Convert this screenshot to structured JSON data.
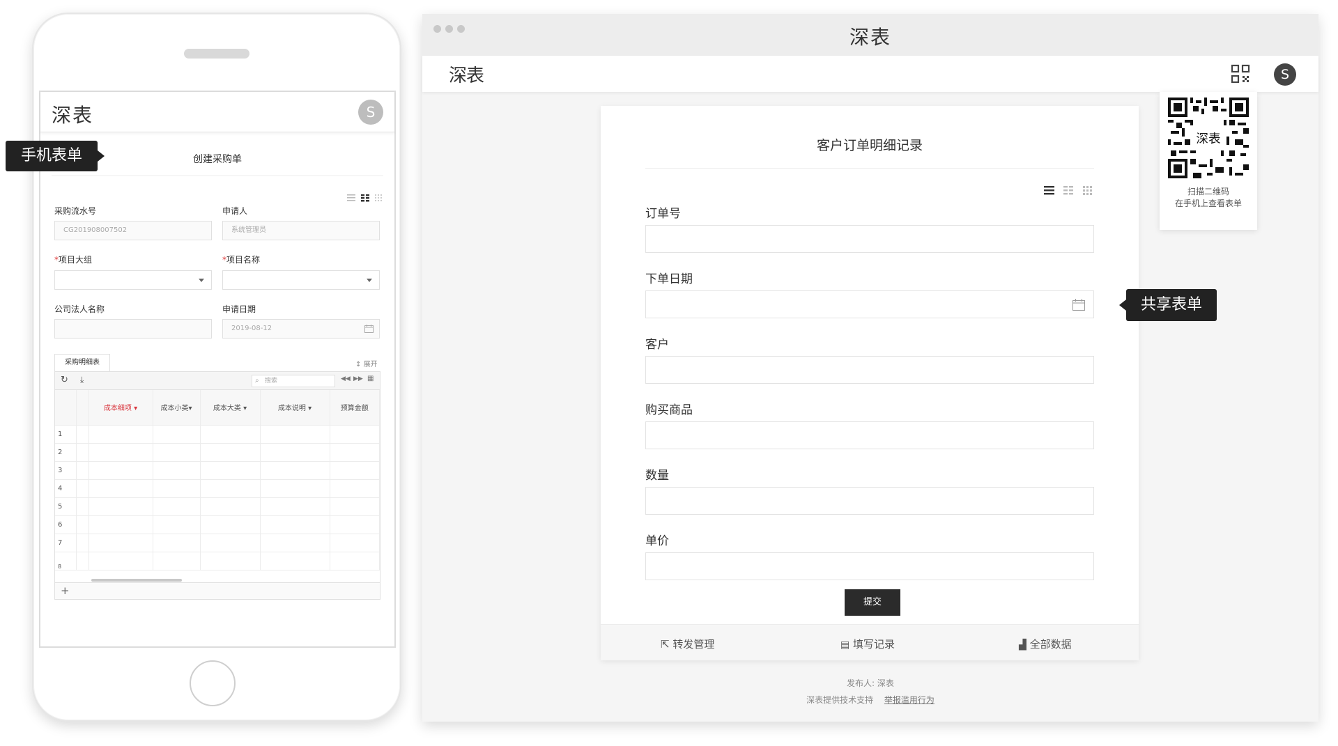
{
  "phone": {
    "app_logo": "深表",
    "avatar_letter": "S",
    "form_title": "创建采购单",
    "fields": [
      {
        "label": "采购流水号",
        "value": "CG201908007502",
        "required": false
      },
      {
        "label": "申请人",
        "value": "系统管理员",
        "required": false
      },
      {
        "label": "项目大组",
        "required": true
      },
      {
        "label": "项目名称",
        "required": true
      },
      {
        "label": "公司法人名称",
        "value": "",
        "required": false
      },
      {
        "label": "申请日期",
        "value": "2019-08-12",
        "required": false
      }
    ],
    "required_mark": "*",
    "subtable": {
      "tab": "采购明细表",
      "expand": "展开",
      "search_placeholder": "搜索",
      "columns": [
        "成本细项",
        "成本小类",
        "成本大类",
        "成本说明",
        "预算金额"
      ],
      "rows": [
        "1",
        "2",
        "3",
        "4",
        "5",
        "6",
        "7",
        "8"
      ],
      "add": "+"
    }
  },
  "tooltips": {
    "mobile": "手机表单",
    "shared": "共享表单"
  },
  "browser": {
    "title": "深表",
    "logo": "深表",
    "avatar_letter": "S",
    "qr": {
      "line1": "扫描二维码",
      "line2": "在手机上查看表单"
    },
    "form": {
      "title": "客户订单明细记录",
      "fields": [
        "订单号",
        "下单日期",
        "客户",
        "购买商品",
        "数量",
        "单价"
      ],
      "submit": "提交"
    },
    "footer": {
      "forward": "转发管理",
      "records": "填写记录",
      "all_data": "全部数据"
    },
    "publisher_label": "发布人:",
    "publisher": "深表",
    "support": "深表提供技术支持",
    "report": "举报滥用行为"
  },
  "colors": {
    "accent_red": "#d9363e",
    "dark": "#222222"
  }
}
